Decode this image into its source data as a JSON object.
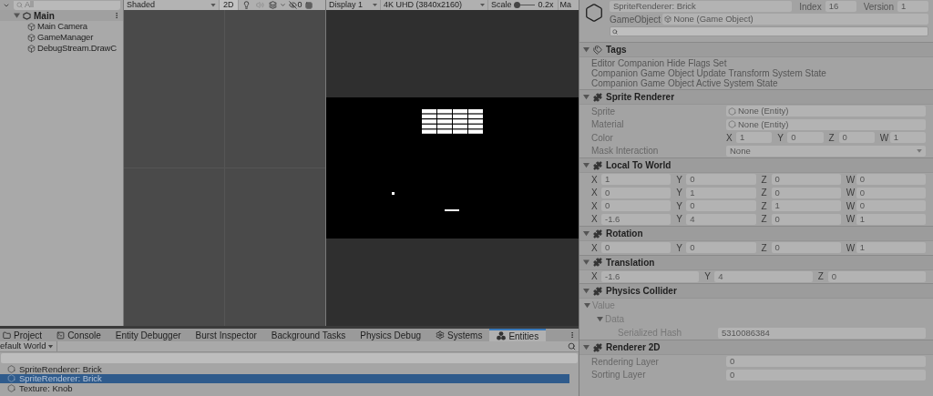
{
  "hierarchy": {
    "search_placeholder": "All",
    "items": [
      {
        "label": "Main",
        "expanded": true,
        "children": [
          {
            "label": "Main Camera"
          },
          {
            "label": "GameManager"
          },
          {
            "label": "DebugStream.DrawC"
          }
        ]
      }
    ]
  },
  "scene_toolbar": {
    "shading": "Shaded",
    "mode_2d": "2D",
    "hidden_count": "0"
  },
  "game_toolbar": {
    "display": "Display 1",
    "resolution": "4K UHD (3840x2160)",
    "scale_label": "Scale",
    "scale": {
      "level": 0.1
    },
    "scale_value": "0.2x",
    "cut_label": "Ma"
  },
  "bottom_panel": {
    "tabs": [
      {
        "label": "Project",
        "kind": "folder",
        "selected": false
      },
      {
        "label": "Console",
        "kind": "console",
        "selected": false
      },
      {
        "label": "Entity Debugger",
        "kind": "plain",
        "selected": false
      },
      {
        "label": "Burst Inspector",
        "kind": "plain",
        "selected": false
      },
      {
        "label": "Background Tasks",
        "kind": "plain",
        "selected": false
      },
      {
        "label": "Physics Debug",
        "kind": "plain",
        "selected": false
      },
      {
        "label": "Systems",
        "kind": "systems",
        "selected": false
      },
      {
        "label": "Entities",
        "kind": "entities",
        "selected": true
      }
    ],
    "world": "efault World",
    "rows": [
      {
        "label": "SpriteRenderer: Brick",
        "selected": false
      },
      {
        "label": "SpriteRenderer: Brick",
        "selected": true
      },
      {
        "label": "Texture: Knob",
        "selected": false
      }
    ]
  },
  "inspector": {
    "entity_name": "SpriteRenderer: Brick",
    "index_label": "Index",
    "index": "16",
    "version_label": "Version",
    "version": "1",
    "gameobject_label": "GameObject",
    "gameobject_value": "None (Game Object)",
    "sections": [
      {
        "title": "Tags",
        "kind": "tags",
        "expanded": true,
        "items": [
          "Editor Companion Hide Flags Set",
          "Companion Game Object Update Transform System State",
          "Companion Game Object Active System State"
        ]
      },
      {
        "title": "Sprite Renderer",
        "kind": "properties",
        "expanded": true,
        "rows": [
          {
            "label": "Sprite",
            "kind": "object",
            "value": "None (Entity)"
          },
          {
            "label": "Material",
            "kind": "object",
            "value": "None (Entity)"
          },
          {
            "label": "Color",
            "kind": "vector",
            "components": [
              {
                "axis": "X",
                "value": "1"
              },
              {
                "axis": "Y",
                "value": "0"
              },
              {
                "axis": "Z",
                "value": "0"
              },
              {
                "axis": "W",
                "value": "1"
              }
            ]
          },
          {
            "label": "Mask Interaction",
            "kind": "dropdown",
            "value": "None"
          }
        ]
      },
      {
        "title": "Local To World",
        "kind": "matrix",
        "expanded": true,
        "rows": [
          [
            {
              "axis": "X",
              "value": "1"
            },
            {
              "axis": "Y",
              "value": "0"
            },
            {
              "axis": "Z",
              "value": "0"
            },
            {
              "axis": "W",
              "value": "0"
            }
          ],
          [
            {
              "axis": "X",
              "value": "0"
            },
            {
              "axis": "Y",
              "value": "1"
            },
            {
              "axis": "Z",
              "value": "0"
            },
            {
              "axis": "W",
              "value": "0"
            }
          ],
          [
            {
              "axis": "X",
              "value": "0"
            },
            {
              "axis": "Y",
              "value": "0"
            },
            {
              "axis": "Z",
              "value": "1"
            },
            {
              "axis": "W",
              "value": "0"
            }
          ],
          [
            {
              "axis": "X",
              "value": "-1.6"
            },
            {
              "axis": "Y",
              "value": "4"
            },
            {
              "axis": "Z",
              "value": "0"
            },
            {
              "axis": "W",
              "value": "1"
            }
          ]
        ]
      },
      {
        "title": "Rotation",
        "kind": "matrix",
        "expanded": true,
        "rows": [
          [
            {
              "axis": "X",
              "value": "0"
            },
            {
              "axis": "Y",
              "value": "0"
            },
            {
              "axis": "Z",
              "value": "0"
            },
            {
              "axis": "W",
              "value": "1"
            }
          ]
        ]
      },
      {
        "title": "Translation",
        "kind": "matrix",
        "expanded": true,
        "rows": [
          [
            {
              "axis": "X",
              "value": "-1.6"
            },
            {
              "axis": "Y",
              "value": "4"
            },
            {
              "axis": "Z",
              "value": "0"
            }
          ]
        ]
      },
      {
        "title": "Physics Collider",
        "kind": "tree",
        "expanded": true,
        "items": [
          {
            "label": "Value",
            "expanded": true,
            "children": [
              {
                "label": "Data",
                "expanded": true,
                "children": [
                  {
                    "label": "Serialized Hash",
                    "value": "5310086384"
                  }
                ]
              }
            ]
          }
        ]
      },
      {
        "title": "Renderer 2D",
        "kind": "properties",
        "expanded": true,
        "rows": [
          {
            "label": "Rendering Layer",
            "kind": "text",
            "value": "0"
          },
          {
            "label": "Sorting Layer",
            "kind": "text",
            "value": "0"
          }
        ]
      }
    ]
  }
}
